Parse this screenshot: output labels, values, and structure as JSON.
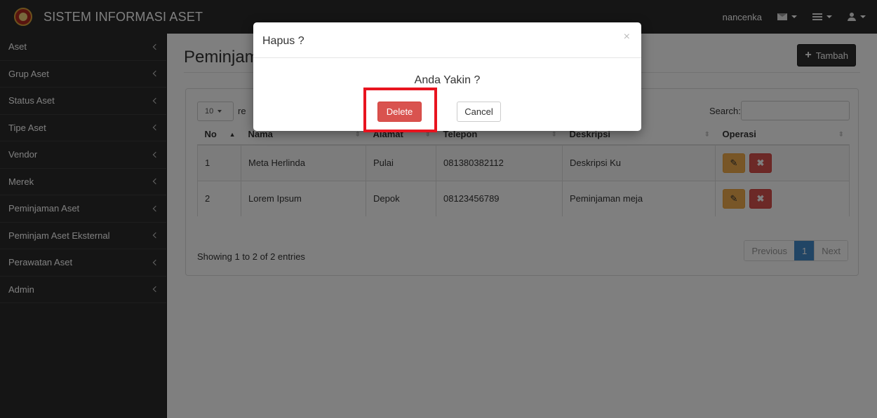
{
  "app": {
    "title": "SISTEM INFORMASI ASET",
    "user": "nancenka"
  },
  "sidebar": {
    "items": [
      {
        "label": "Aset"
      },
      {
        "label": "Grup Aset"
      },
      {
        "label": "Status Aset"
      },
      {
        "label": "Tipe Aset"
      },
      {
        "label": "Vendor"
      },
      {
        "label": "Merek"
      },
      {
        "label": "Peminjaman Aset"
      },
      {
        "label": "Peminjam Aset Eksternal"
      },
      {
        "label": "Perawatan Aset"
      },
      {
        "label": "Admin"
      }
    ]
  },
  "main": {
    "title": "Peminjam",
    "add_button": "Tambah",
    "length_value": "10",
    "length_label": "re",
    "search_label": "Search:",
    "search_value": "",
    "columns": [
      "No",
      "Nama",
      "Alamat",
      "Telepon",
      "Deskripsi",
      "Operasi"
    ],
    "rows": [
      {
        "no": "1",
        "nama": "Meta Herlinda",
        "alamat": "Pulai",
        "telepon": "081380382112",
        "deskripsi": "Deskripsi Ku"
      },
      {
        "no": "2",
        "nama": "Lorem Ipsum",
        "alamat": "Depok",
        "telepon": "08123456789",
        "deskripsi": "Peminjaman meja"
      }
    ],
    "info": "Showing 1 to 2 of 2 entries",
    "pagination": {
      "previous": "Previous",
      "current": "1",
      "next": "Next"
    }
  },
  "modal": {
    "title": "Hapus ?",
    "close": "×",
    "message": "Anda Yakin ?",
    "delete_label": "Delete",
    "cancel_label": "Cancel"
  },
  "icons": {
    "mail": "envelope-icon",
    "tasks": "tasks-icon",
    "user": "user-icon",
    "edit": "pencil-icon",
    "delete": "times-icon"
  },
  "colors": {
    "danger": "#d9534f",
    "warning": "#f0ad4e",
    "primary": "#428bca",
    "highlight": "#e8141f",
    "topbar": "#2b2b2b"
  }
}
